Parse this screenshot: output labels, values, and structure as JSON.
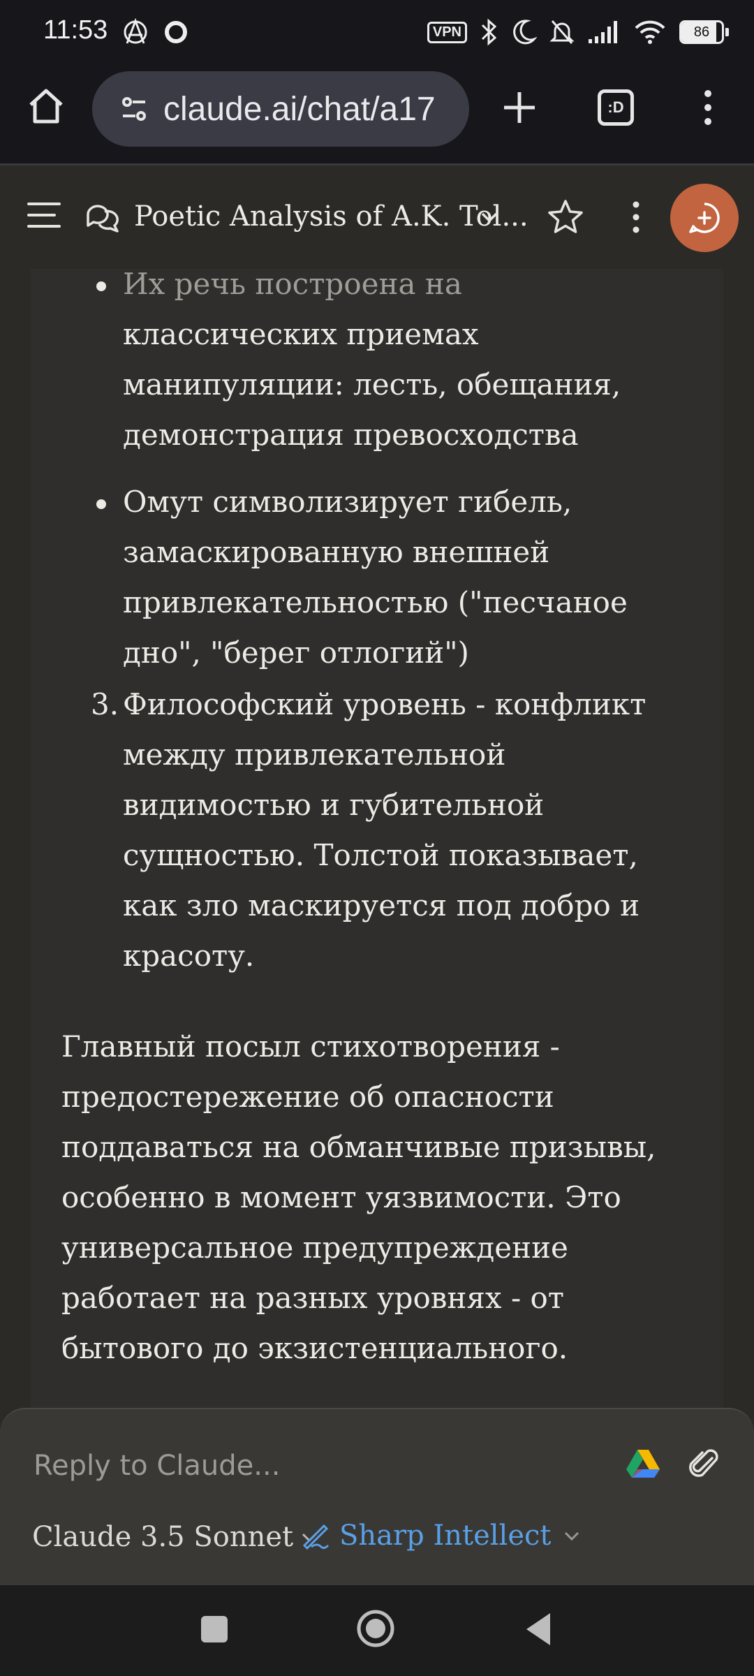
{
  "status_bar": {
    "time": "11:53",
    "vpn": "VPN",
    "battery": "86",
    "signal_sub": "6"
  },
  "browser": {
    "url": "claude.ai/chat/a17",
    "tabs_label": ":D"
  },
  "header": {
    "title": "Poetic Analysis of A.K. Tol..."
  },
  "message": {
    "bullets": [
      "Их речь построена на",
      "классических приемах",
      "манипуляции: лесть, обещания,",
      "демонстрация превосходства"
    ],
    "bullet2": [
      "Омут символизирует гибель,",
      "замаскированную внешней",
      "привлекательностью (\"песчаное",
      "дно\", \"берег отлогий\")"
    ],
    "item3_number": "3.",
    "item3": [
      "Философский уровень - конфликт",
      "между привлекательной",
      "видимостью и губительной",
      "сущностью. Толстой показывает,",
      "как зло маскируется под добро и",
      "красоту."
    ],
    "conclusion": [
      "Главный посыл стихотворения -",
      "предостережение об опасности",
      "поддаваться на обманчивые призывы,",
      "особенно в момент уязвимости. Это",
      "универсальное предупреждение",
      "работает на разных уровнях - от",
      "бытового до экзистенциального."
    ]
  },
  "composer": {
    "placeholder": "Reply to Claude...",
    "model": "Claude 3.5 Sonnet",
    "style": "Sharp Intellect"
  },
  "colors": {
    "accent": "#c2643f",
    "style_link": "#5aa0e6",
    "background": "#2f2e2c"
  }
}
